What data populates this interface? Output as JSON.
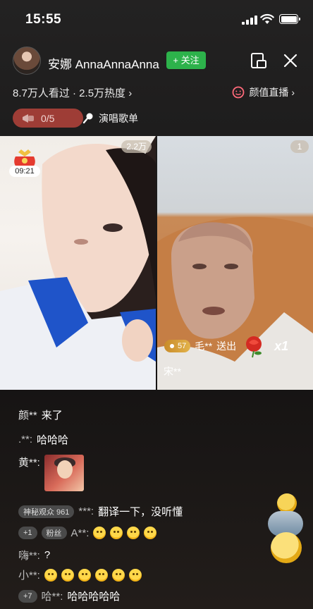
{
  "status_bar": {
    "time": "15:55"
  },
  "header": {
    "streamer_name": "安娜 AnnaAnnaAnna",
    "follow_label": "+ 关注",
    "viewers_text": "8.7万人看过 · 2.5万热度 ›",
    "category_text": "颜值直播 ›"
  },
  "controls": {
    "counter_text": "0/5",
    "songs_label": "演唱歌单"
  },
  "video_left": {
    "badge": "2.2万",
    "timer": "09:21"
  },
  "video_right": {
    "badge": "1",
    "gift_level": "57",
    "gift_user": "毛**",
    "gift_verb": "送出",
    "gift_count": "x1",
    "song_user": "宋**"
  },
  "chat": [
    {
      "user": "颜**",
      "text": "来了"
    },
    {
      "user": ".**:",
      "text": "哈哈哈"
    },
    {
      "user": "黄**:",
      "text": ""
    },
    {
      "tag": "神秘观众 961",
      "user": "***:",
      "text": "翻译一下，没听懂"
    },
    {
      "tag1": "+1",
      "tag2": "粉丝",
      "user": "A**:",
      "emoji_count": 4
    },
    {
      "user": "嗨**:",
      "text": "?"
    },
    {
      "user": "小**:",
      "emoji_count": 6
    },
    {
      "tag1": "+7",
      "user": "哈**:",
      "text": "哈哈哈哈哈"
    }
  ],
  "colors": {
    "follow_green": "#2db24b",
    "counter_red": "#9e3d36",
    "gift_gold": "#e2b24a"
  }
}
